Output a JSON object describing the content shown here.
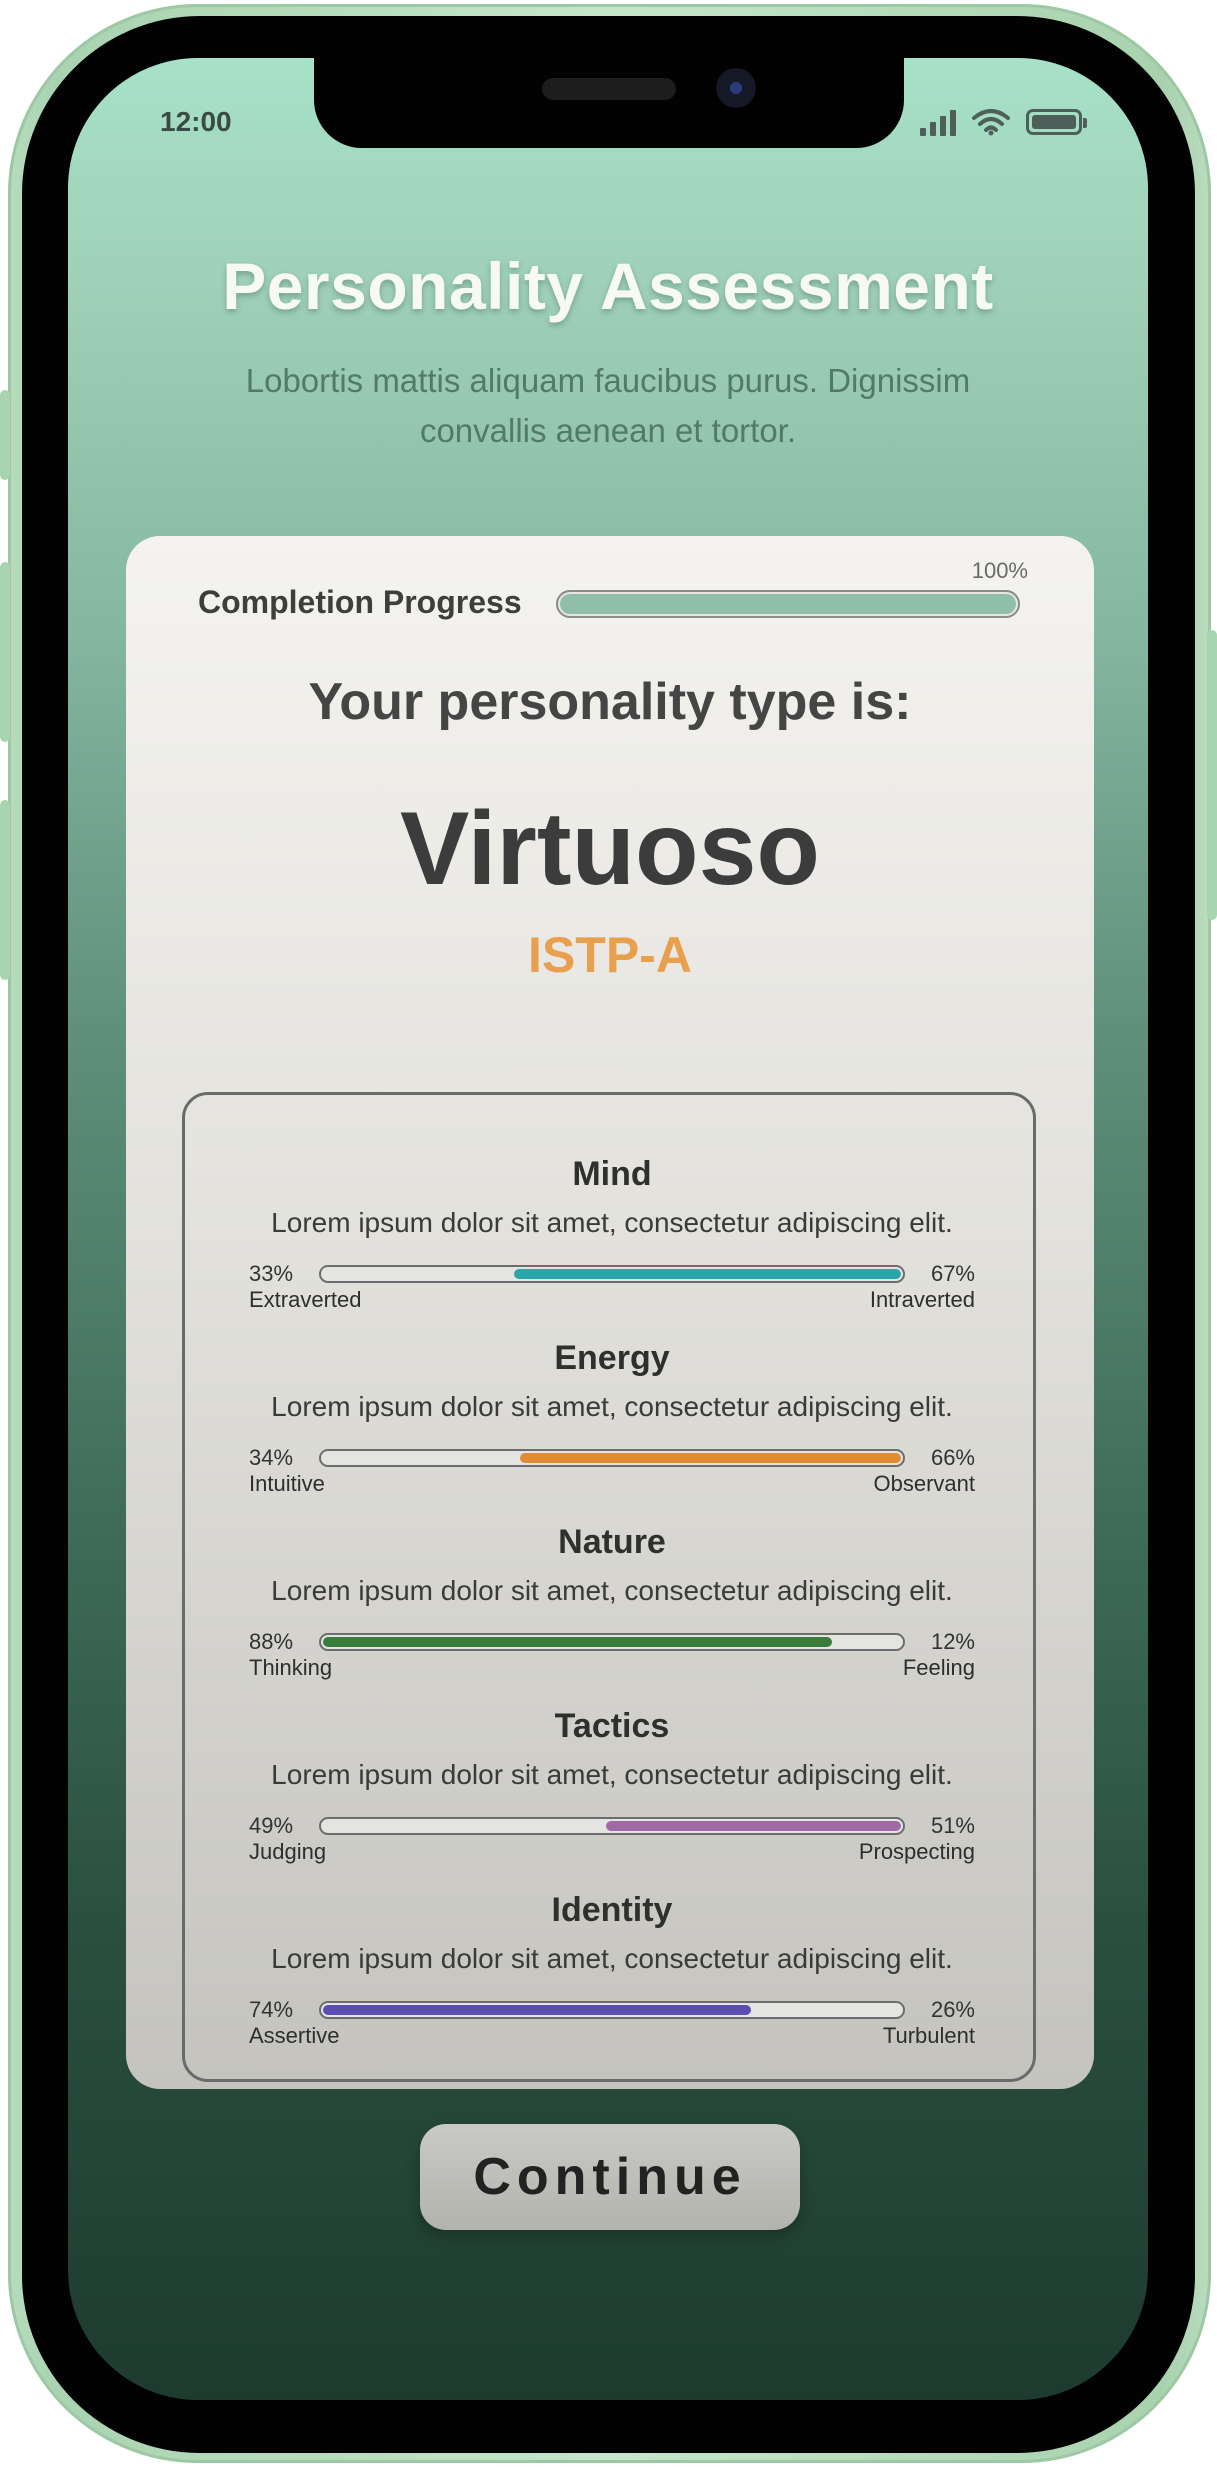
{
  "status_bar": {
    "time": "12:00"
  },
  "header": {
    "title": "Personality Assessment",
    "subtitle": "Lobortis mattis aliquam faucibus purus. Dignissim convallis aenean et tortor."
  },
  "progress": {
    "label": "Completion Progress",
    "percent_text": "100%",
    "value": 1.0
  },
  "result": {
    "heading": "Your personality type is:",
    "name": "Virtuoso",
    "code": "ISTP-A"
  },
  "traits": [
    {
      "name": "Mind",
      "description": "Lorem ipsum dolor sit amet, consectetur adipiscing elit.",
      "left_pct": "33%",
      "right_pct": "67%",
      "left_label": "Extraverted",
      "right_label": "Intraverted",
      "dominant": "right",
      "value": 0.67,
      "color": "#2aa5a8"
    },
    {
      "name": "Energy",
      "description": "Lorem ipsum dolor sit amet, consectetur adipiscing elit.",
      "left_pct": "34%",
      "right_pct": "66%",
      "left_label": "Intuitive",
      "right_label": "Observant",
      "dominant": "right",
      "value": 0.66,
      "color": "#e08b35"
    },
    {
      "name": "Nature",
      "description": "Lorem ipsum dolor sit amet, consectetur adipiscing elit.",
      "left_pct": "88%",
      "right_pct": "12%",
      "left_label": "Thinking",
      "right_label": "Feeling",
      "dominant": "left",
      "value": 0.88,
      "color": "#3a7d3a"
    },
    {
      "name": "Tactics",
      "description": "Lorem ipsum dolor sit amet, consectetur adipiscing elit.",
      "left_pct": "49%",
      "right_pct": "51%",
      "left_label": "Judging",
      "right_label": "Prospecting",
      "dominant": "right",
      "value": 0.51,
      "color": "#a06aa6"
    },
    {
      "name": "Identity",
      "description": "Lorem ipsum dolor sit amet, consectetur adipiscing elit.",
      "left_pct": "74%",
      "right_pct": "26%",
      "left_label": "Assertive",
      "right_label": "Turbulent",
      "dominant": "left",
      "value": 0.74,
      "color": "#5a4fb0"
    }
  ],
  "actions": {
    "continue_label": "Continue"
  },
  "icons": {
    "signal": "cellular-signal-icon",
    "wifi": "wifi-icon",
    "battery": "battery-icon"
  }
}
